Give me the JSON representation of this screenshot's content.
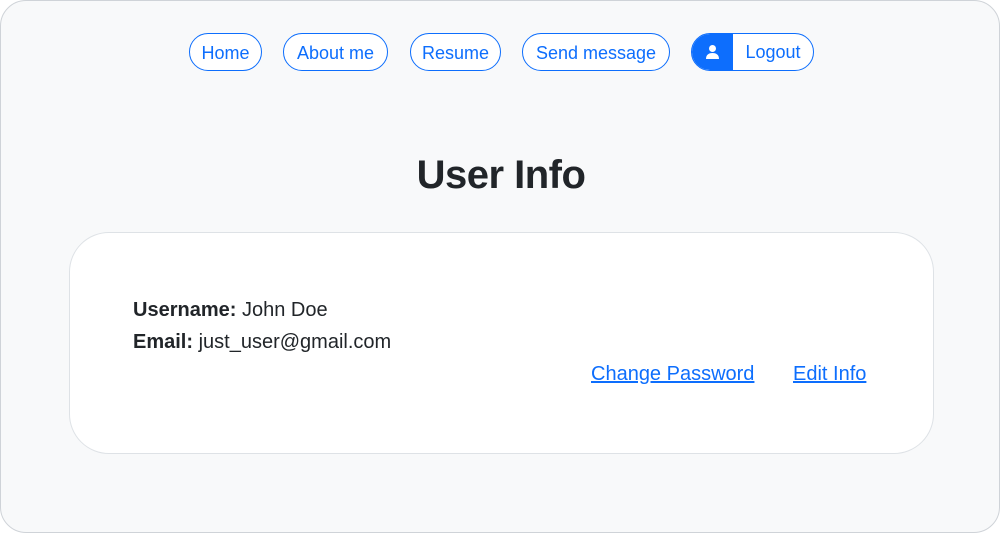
{
  "nav": {
    "items": [
      {
        "label": "Home"
      },
      {
        "label": "About me"
      },
      {
        "label": "Resume"
      },
      {
        "label": "Send message"
      }
    ],
    "logout": {
      "label": "Logout",
      "icon": "user-icon"
    }
  },
  "page": {
    "title": "User Info"
  },
  "user": {
    "username_label": "Username:",
    "username": "John Doe",
    "email_label": "Email:",
    "email": "just_user@gmail.com"
  },
  "actions": {
    "change_password": "Change Password",
    "edit_info": "Edit Info"
  },
  "colors": {
    "accent": "#0d6efd",
    "background": "#f8f9fa",
    "card": "#ffffff",
    "text": "#212529"
  }
}
